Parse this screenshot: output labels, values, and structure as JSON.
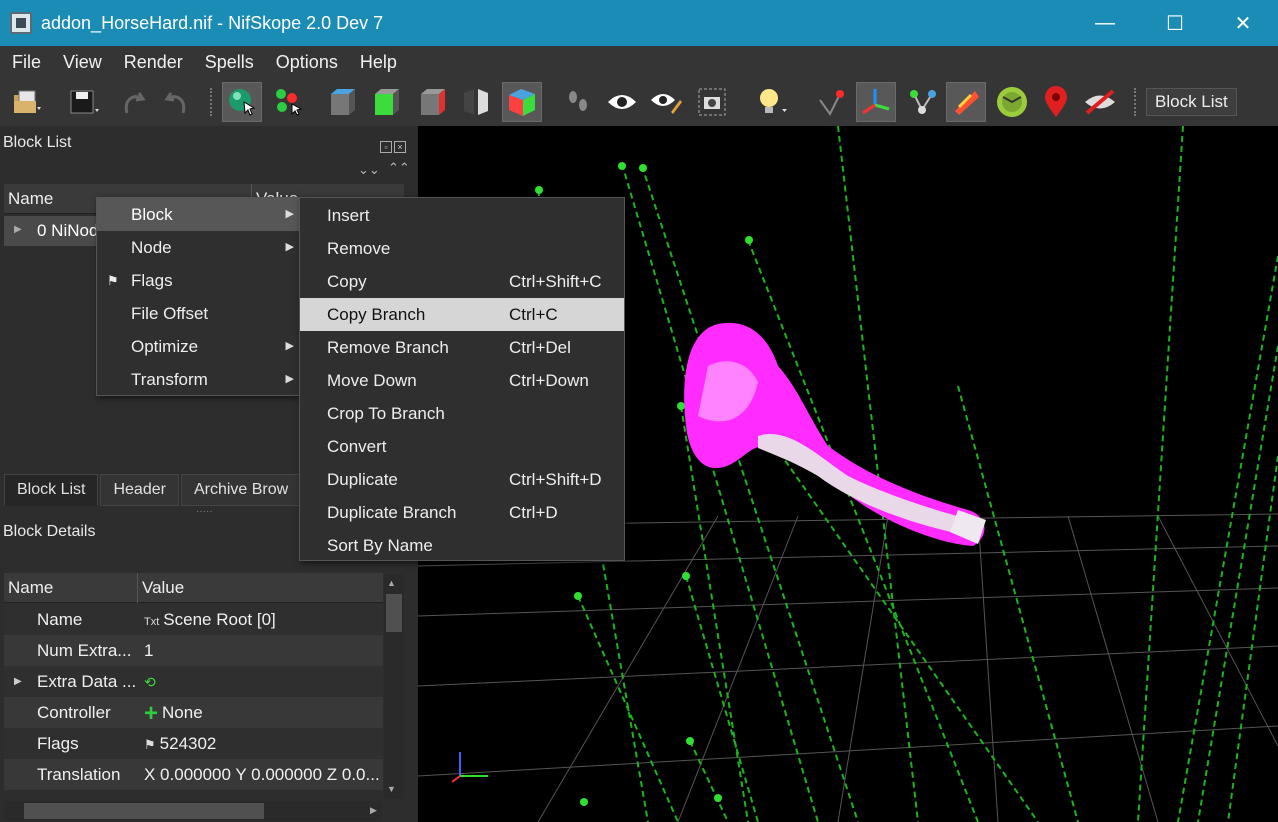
{
  "window": {
    "title": "addon_HorseHard.nif - NifSkope 2.0 Dev 7",
    "minimize": "—",
    "maximize": "☐",
    "close": "✕"
  },
  "menubar": [
    "File",
    "View",
    "Render",
    "Spells",
    "Options",
    "Help"
  ],
  "toolbar": {
    "icons": [
      "load-icon",
      "save-icon",
      "undo-icon",
      "redo-icon",
      "select-object-icon",
      "select-vertex-icon",
      "view-top-icon",
      "view-front-icon",
      "view-side-icon",
      "view-flip-icon",
      "view-user-icon",
      "walk-icon",
      "eye-icon",
      "eye-edit-icon",
      "screenshot-icon",
      "light-icon",
      "marker-icon",
      "axes-icon",
      "nodes-icon",
      "constraints-icon",
      "furniture-icon",
      "location-icon",
      "hidden-icon"
    ],
    "block_list_button": "Block List"
  },
  "block_list_panel": {
    "title": "Block List",
    "columns": [
      "Name",
      "Value"
    ],
    "root_row": "0 NiNode"
  },
  "tabs": [
    "Block List",
    "Header",
    "Archive Brow"
  ],
  "block_details": {
    "title": "Block Details",
    "columns": [
      "Name",
      "Value"
    ],
    "rows": [
      {
        "name": "Name",
        "icon": "Txt",
        "value": "Scene Root [0]"
      },
      {
        "name": "Num Extra...",
        "icon": "",
        "value": "1"
      },
      {
        "name": "Extra Data ...",
        "icon": "⟲",
        "value": ""
      },
      {
        "name": "Controller",
        "icon": "+",
        "value": "None"
      },
      {
        "name": "Flags",
        "icon": "⚑",
        "value": "524302"
      },
      {
        "name": "Translation",
        "icon": "",
        "value": "X 0.000000 Y 0.000000 Z 0.0..."
      }
    ]
  },
  "context_menu": {
    "items": [
      {
        "label": "Block",
        "submenu": true
      },
      {
        "label": "Node",
        "submenu": true
      },
      {
        "label": "Flags",
        "submenu": false
      },
      {
        "label": "File Offset",
        "submenu": false
      },
      {
        "label": "Optimize",
        "submenu": true
      },
      {
        "label": "Transform",
        "submenu": true
      }
    ],
    "highlighted": "Block"
  },
  "block_submenu": {
    "items": [
      {
        "label": "Insert",
        "shortcut": ""
      },
      {
        "label": "Remove",
        "shortcut": ""
      },
      {
        "label": "Copy",
        "shortcut": "Ctrl+Shift+C"
      },
      {
        "label": "Copy Branch",
        "shortcut": "Ctrl+C"
      },
      {
        "label": "Remove Branch",
        "shortcut": "Ctrl+Del"
      },
      {
        "label": "Move Down",
        "shortcut": "Ctrl+Down"
      },
      {
        "label": "Crop To Branch",
        "shortcut": ""
      },
      {
        "label": "Convert",
        "shortcut": ""
      },
      {
        "label": "Duplicate",
        "shortcut": "Ctrl+Shift+D"
      },
      {
        "label": "Duplicate Branch",
        "shortcut": "Ctrl+D"
      },
      {
        "label": "Sort By Name",
        "shortcut": ""
      }
    ],
    "highlighted": "Copy Branch"
  },
  "colors": {
    "titlebar": "#1b8cb5",
    "mesh": "#ff00ff",
    "bones": "#00cc33"
  }
}
